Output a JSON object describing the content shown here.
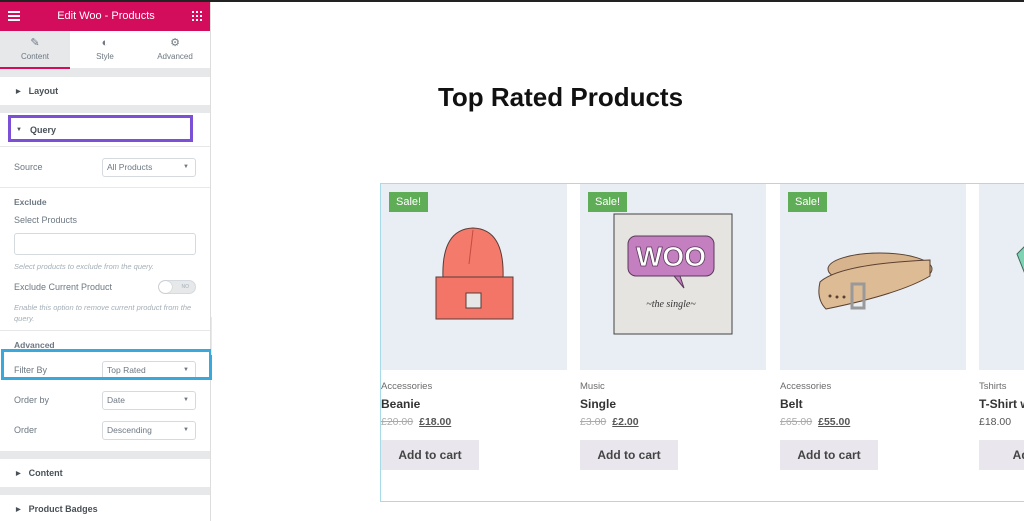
{
  "sidebar": {
    "header_title": "Edit Woo - Products",
    "tabs": [
      {
        "label": "Content",
        "icon": "pencil-icon",
        "active": true
      },
      {
        "label": "Style",
        "icon": "half-circle-icon",
        "active": false
      },
      {
        "label": "Advanced",
        "icon": "gear-icon",
        "active": false
      }
    ],
    "sections": {
      "layout": "Layout",
      "query": "Query",
      "content": "Content",
      "badges": "Product Badges"
    },
    "query": {
      "source_label": "Source",
      "source_value": "All Products",
      "exclude_title": "Exclude",
      "select_products_label": "Select Products",
      "select_products_value": "",
      "select_products_hint": "Select products to exclude from the query.",
      "exclude_current_label": "Exclude Current Product",
      "exclude_current_toggle": "NO",
      "exclude_current_hint": "Enable this option to remove current product from the query.",
      "advanced_title": "Advanced",
      "filter_by_label": "Filter By",
      "filter_by_value": "Top Rated",
      "order_by_label": "Order by",
      "order_by_value": "Date",
      "order_label": "Order",
      "order_value": "Descending"
    }
  },
  "main": {
    "title": "Top Rated Products",
    "products": [
      {
        "category": "Accessories",
        "name": "Beanie",
        "old_price": "£20.00",
        "price": "£18.00",
        "sale": "Sale!",
        "button": "Add to cart"
      },
      {
        "category": "Music",
        "name": "Single",
        "old_price": "£3.00",
        "price": "£2.00",
        "sale": "Sale!",
        "button": "Add to cart"
      },
      {
        "category": "Accessories",
        "name": "Belt",
        "old_price": "£65.00",
        "price": "£55.00",
        "sale": "Sale!",
        "button": "Add to cart"
      },
      {
        "category": "Tshirts",
        "name": "T-Shirt w",
        "price": "£18.00",
        "button": "Add t"
      }
    ]
  },
  "colors": {
    "brand": "#d30c5c",
    "sale_badge": "#5fad56",
    "query_highlight": "#7b4fd6",
    "filter_highlight": "#3ba8db"
  }
}
